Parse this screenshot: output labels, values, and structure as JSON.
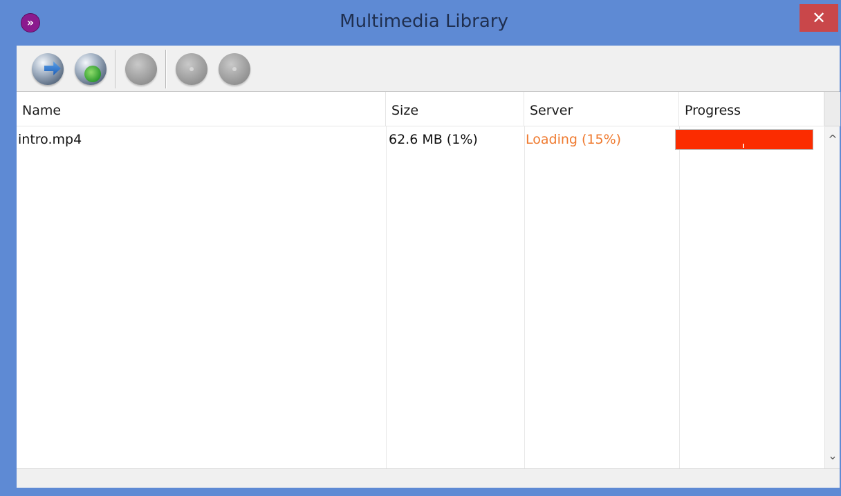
{
  "window": {
    "title": "Multimedia Library",
    "app_icon_glyph": "»",
    "close_glyph": "✕"
  },
  "toolbar": {
    "buttons": [
      {
        "icon": "globe-download-icon",
        "enabled": true
      },
      {
        "icon": "globe-network-icon",
        "enabled": true
      },
      {
        "icon": "disc-icon",
        "enabled": false
      },
      {
        "icon": "disc-add-icon",
        "enabled": false
      },
      {
        "icon": "disc-remove-icon",
        "enabled": false
      }
    ]
  },
  "list": {
    "columns": [
      "Name",
      "Size",
      "Server",
      "Progress"
    ],
    "rows": [
      {
        "name": "intro.mp4",
        "size": "62.6 MB (1%)",
        "server": "Loading (15%)",
        "progress": 1.0
      }
    ]
  },
  "scrollbar": {
    "up_glyph": "^",
    "down_glyph": "⌄"
  },
  "colors": {
    "titlebar": "#5e8ad4",
    "close_button": "#c9474a",
    "server_status": "#ef7a2f",
    "progress_fill": "#fb2c00"
  }
}
